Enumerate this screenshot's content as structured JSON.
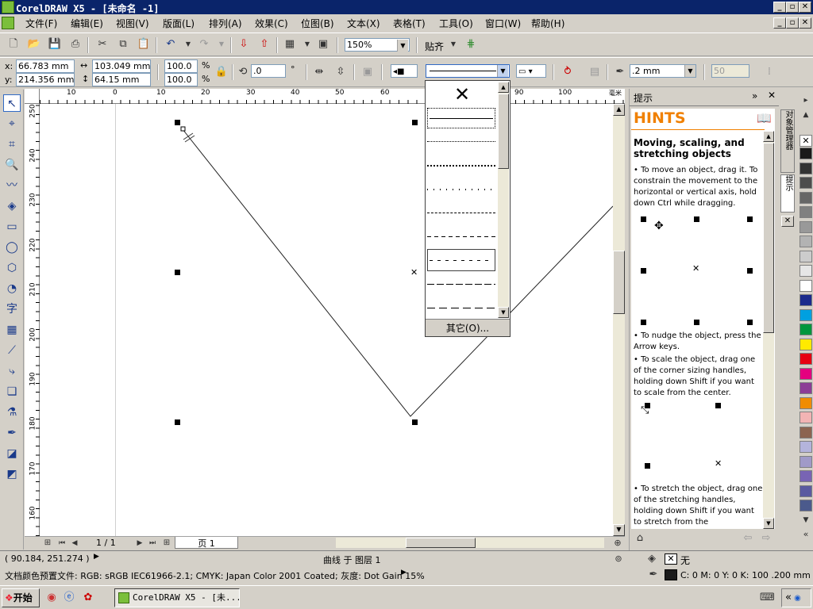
{
  "window": {
    "title": "CorelDRAW X5 - [未命名 -1]"
  },
  "menu": [
    "文件(F)",
    "编辑(E)",
    "视图(V)",
    "版面(L)",
    "排列(A)",
    "效果(C)",
    "位图(B)",
    "文本(X)",
    "表格(T)",
    "工具(O)",
    "窗口(W)",
    "帮助(H)"
  ],
  "toolbar": {
    "zoom": "150%",
    "snap_label": "贴齐"
  },
  "propbar": {
    "x_label": "x:",
    "x": "66.783 mm",
    "y_label": "y:",
    "y": "214.356 mm",
    "w": "103.049 mm",
    "h": "64.15 mm",
    "scale_x": "100.0",
    "scale_y": "100.0",
    "pct": "%",
    "rotation": ".0",
    "deg": "°",
    "outline_width": ".2 mm",
    "smooth": "50"
  },
  "ruler": {
    "top": [
      "10",
      "0",
      "10",
      "20",
      "30",
      "40",
      "50",
      "60",
      "90",
      "100"
    ],
    "left": [
      "250",
      "240",
      "230",
      "220",
      "210",
      "200",
      "190",
      "180",
      "170",
      "160"
    ],
    "unit": "毫米"
  },
  "line_dropdown": {
    "other_label": "其它(O)..."
  },
  "docker": {
    "title": "提示",
    "hints_title": "HINTS",
    "heading": "Moving, scaling, and stretching objects",
    "bullet1": "To move an object, drag it. To constrain the movement to the horizontal or vertical axis, hold down Ctrl while dragging.",
    "bullet2": "To nudge the object, press the Arrow keys.",
    "bullet3": "To scale the object, drag one of the corner sizing handles, holding down Shift if you want to scale from the center.",
    "bullet4": "To stretch the object, drag one of the stretching handles, holding down Shift if you want to stretch from the",
    "tab1": "对象管理器",
    "tab2": "提示"
  },
  "page_nav": {
    "counter": "1 / 1",
    "page_tab": "页 1"
  },
  "status": {
    "coords": "( 90.184, 251.274 )",
    "object_info": "曲线 于 图层 1",
    "color_profile": "文档颜色预置文件: RGB: sRGB IEC61966-2.1; CMYK: Japan Color 2001 Coated; 灰度: Dot Gain 15%",
    "fill": "无",
    "outline": "C: 0 M: 0 Y: 0 K: 100  .200 mm"
  },
  "taskbar": {
    "start": "开始",
    "task": "CorelDRAW X5 - [未..."
  },
  "palette_colors": [
    "#1a1a1a",
    "#333333",
    "#4d4d4d",
    "#666666",
    "#808080",
    "#999999",
    "#b3b3b3",
    "#cccccc",
    "#e6e6e6",
    "#ffffff",
    "#1b2a8c",
    "#00a0e0",
    "#00963c",
    "#ffea00",
    "#e60012",
    "#e4007f",
    "#8c3c96",
    "#f08c00",
    "#f2b4b4",
    "#8c6450",
    "#b4b4dc",
    "#a09ac8",
    "#7864b4",
    "#5a5aa0",
    "#4b5a8c"
  ]
}
